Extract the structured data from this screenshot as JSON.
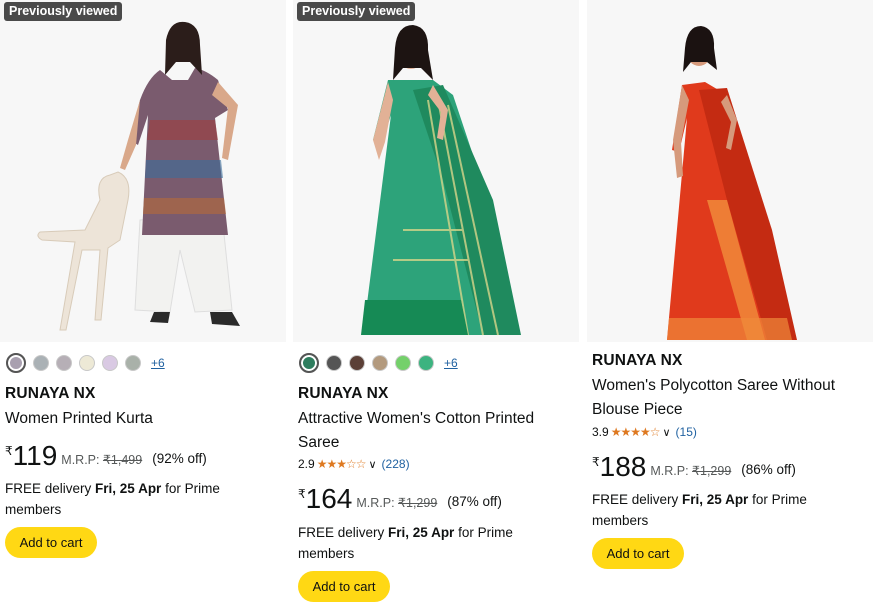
{
  "products": [
    {
      "badge": "Previously viewed",
      "brand": "RUNAYA NX",
      "title": "Women Printed Kurta",
      "swatches": [
        "#a9a0b0",
        "#aab1b5",
        "#b6afb6",
        "#ede9d6",
        "#d9c9e3",
        "#a9b1a9"
      ],
      "more": "+6",
      "currency": "₹",
      "price": "119",
      "mrp_label": "M.R.P:",
      "mrp": "₹1,499",
      "discount": "(92% off)",
      "delivery_prefix": "FREE delivery",
      "delivery_date": "Fri, 25 Apr",
      "delivery_suffix": "for Prime members",
      "cart": "Add to cart"
    },
    {
      "badge": "Previously viewed",
      "brand": "RUNAYA NX",
      "title": "Attractive Women's Cotton Printed Saree",
      "swatches": [
        "#2e7d5e",
        "#555555",
        "#5c4037",
        "#b39a7e",
        "#74d06a",
        "#3cb380"
      ],
      "more": "+6",
      "rating": "2.9",
      "rating_value": 2.9,
      "review_count": "(228)",
      "currency": "₹",
      "price": "164",
      "mrp_label": "M.R.P:",
      "mrp": "₹1,299",
      "discount": "(87% off)",
      "delivery_prefix": "FREE delivery",
      "delivery_date": "Fri, 25 Apr",
      "delivery_suffix": "for Prime members",
      "cart": "Add to cart"
    },
    {
      "brand": "RUNAYA NX",
      "title": "Women's Polycotton Saree Without Blouse Piece",
      "rating": "3.9",
      "rating_value": 3.9,
      "review_count": "(15)",
      "currency": "₹",
      "price": "188",
      "mrp_label": "M.R.P:",
      "mrp": "₹1,299",
      "discount": "(86% off)",
      "delivery_prefix": "FREE delivery",
      "delivery_date": "Fri, 25 Apr",
      "delivery_suffix": "for Prime members",
      "cart": "Add to cart"
    }
  ],
  "colors": {
    "cart_button": "#ffd814",
    "star": "#de7921",
    "link": "#2162a1",
    "badge_bg": "#4a4a4a"
  },
  "icons": [
    "chevron-down-icon",
    "star-icon"
  ]
}
